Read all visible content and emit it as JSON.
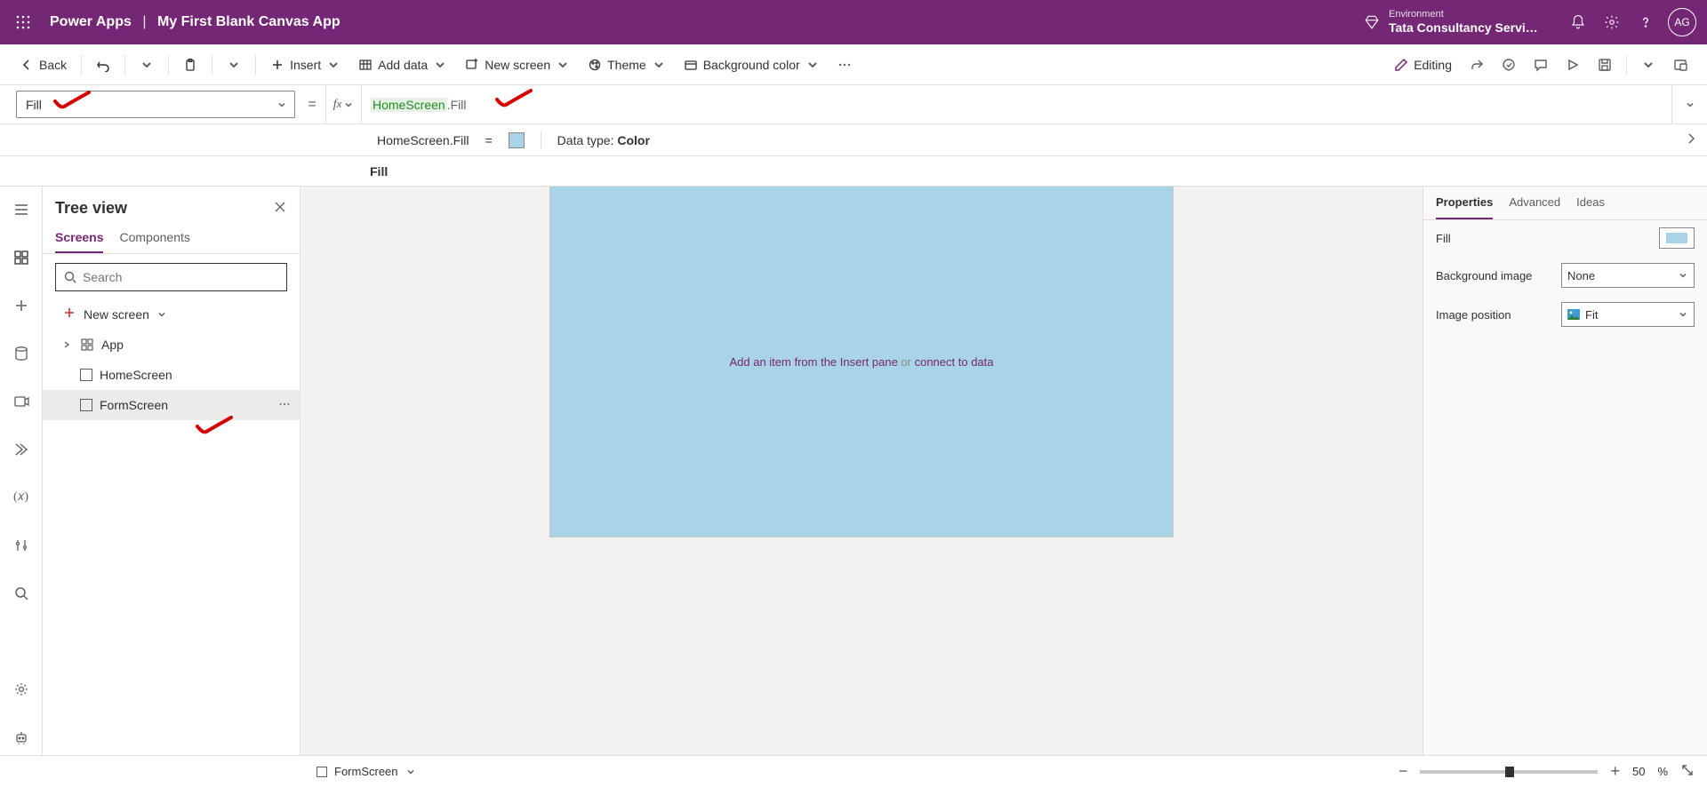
{
  "header": {
    "product": "Power Apps",
    "app_name": "My First Blank Canvas App",
    "env_label": "Environment",
    "env_name": "Tata Consultancy Servic...",
    "avatar": "AG"
  },
  "cmdbar": {
    "back": "Back",
    "insert": "Insert",
    "add_data": "Add data",
    "new_screen": "New screen",
    "theme": "Theme",
    "bg_color": "Background color",
    "editing": "Editing"
  },
  "formula": {
    "property": "Fill",
    "expr_screen": "HomeScreen",
    "expr_prop": ".Fill",
    "result_label": "HomeScreen.Fill",
    "eq": "=",
    "datatype_label": "Data type: ",
    "datatype_value": "Color",
    "fill_label": "Fill"
  },
  "tree": {
    "title": "Tree view",
    "tabs": {
      "screens": "Screens",
      "components": "Components"
    },
    "search_placeholder": "Search",
    "new_screen": "New screen",
    "items": [
      "App",
      "HomeScreen",
      "FormScreen"
    ]
  },
  "canvas": {
    "placeholder_a": "Add an item from the Insert pane ",
    "placeholder_or": "or ",
    "placeholder_b": "connect to data"
  },
  "props": {
    "tabs": {
      "properties": "Properties",
      "advanced": "Advanced",
      "ideas": "Ideas"
    },
    "rows": {
      "fill": "Fill",
      "bg_image": "Background image",
      "bg_image_val": "None",
      "img_pos": "Image position",
      "img_pos_val": "Fit"
    }
  },
  "status": {
    "selected": "FormScreen",
    "zoom": "50",
    "pct": "%"
  }
}
